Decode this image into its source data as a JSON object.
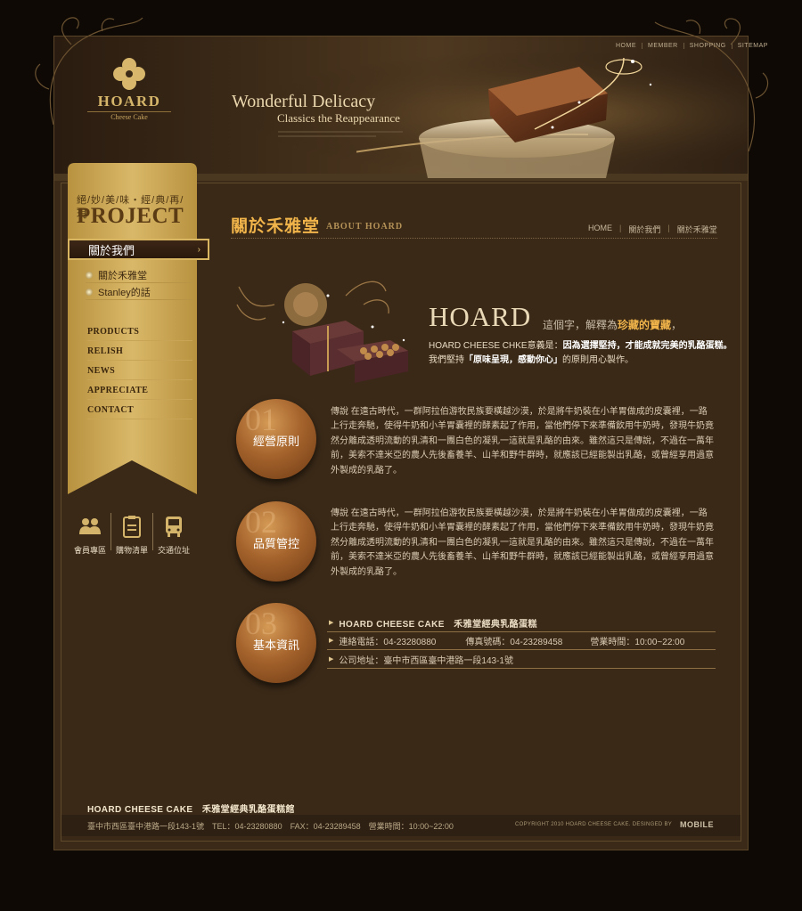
{
  "brand": {
    "name": "HOARD",
    "tagline": "Cheese Cake"
  },
  "slogan": {
    "line1": "Wonderful Delicacy",
    "line2": "Classics the Reappearance"
  },
  "topnav": [
    "HOME",
    "MEMBER",
    "SHOPPING",
    "SITEMAP"
  ],
  "sidebar": {
    "project_small": "絕/妙/美/味・經/典/再/現",
    "project_big": "PROJECT",
    "active_item": "關於我們",
    "sub_items": [
      "關於禾雅堂",
      "Stanley的話"
    ],
    "menu": [
      "PRODUCTS",
      "RELISH",
      "NEWS",
      "APPRECIATE",
      "CONTACT"
    ]
  },
  "quick_links": [
    "會員專區",
    "購物清單",
    "交通位址"
  ],
  "page": {
    "title": "關於禾雅堂",
    "subtitle": "ABOUT HOARD",
    "breadcrumb": [
      "HOME",
      "關於我們",
      "關於禾雅堂"
    ]
  },
  "intro": {
    "big": "HOARD",
    "tag_prefix": "這個字，解釋為",
    "tag_highlight": "珍藏的寶藏",
    "tag_suffix": "，",
    "line1_a": "HOARD CHEESE CHKE意義是：",
    "line1_b": "因為選擇堅持，才能成就完美的乳酪蛋糕。",
    "line2_a": "我們堅持",
    "line2_b": "「原味呈現，感動你心」",
    "line2_c": "的原則用心製作。"
  },
  "sections": [
    {
      "num": "01",
      "label": "經營原則",
      "text": "傳說 在遠古時代，一群阿拉伯游牧民族要橫越沙漠，於是將牛奶裝在小羊胃做成的皮囊裡，一路上行走奔馳，使得牛奶和小羊胃囊裡的酵素起了作用，當他們停下來準備飲用牛奶時，發現牛奶竟然分離成透明流動的乳清和一團白色的凝乳一這就是乳酪的由來。雖然這只是傳說，不過在一萬年前，美索不達米亞的農人先後畜養羊、山羊和野牛群時，就應該已經能製出乳酪，或曾經享用過意外製成的乳酪了。"
    },
    {
      "num": "02",
      "label": "品質管控",
      "text": "傳說 在遠古時代，一群阿拉伯游牧民族要橫越沙漠，於是將牛奶裝在小羊胃做成的皮囊裡，一路上行走奔馳，使得牛奶和小羊胃囊裡的酵素起了作用，當他們停下來準備飲用牛奶時，發現牛奶竟然分離成透明流動的乳清和一團白色的凝乳一這就是乳酪的由來。雖然這只是傳說，不過在一萬年前，美索不達米亞的農人先後畜養羊、山羊和野牛群時，就應該已經能製出乳酪，或曾經享用過意外製成的乳酪了。"
    },
    {
      "num": "03",
      "label": "基本資訊"
    }
  ],
  "info": {
    "title": "HOARD CHEESE CAKE　禾雅堂經典乳酪蛋糕",
    "phone": "連絡電話：04-23280880",
    "fax": "傳真號碼：04-23289458",
    "hours": "營業時間：10:00~22:00",
    "address": "公司地址：臺中市西區臺中港路一段143-1號"
  },
  "footer": {
    "title": "HOARD CHEESE CAKE　禾雅堂經典乳酪蛋糕館",
    "address": "臺中市西區臺中港路一段143-1號　TEL：04-23280880　FAX：04-23289458　營業時間：10:00~22:00",
    "copyright": "COPYRIGHT 2010 HOARD CHEESE CAKE. DESINGED BY",
    "designer": "MOBILE"
  },
  "colors": {
    "accent": "#f0b44a",
    "gold": "#c9a04a",
    "background": "#3a2917"
  }
}
